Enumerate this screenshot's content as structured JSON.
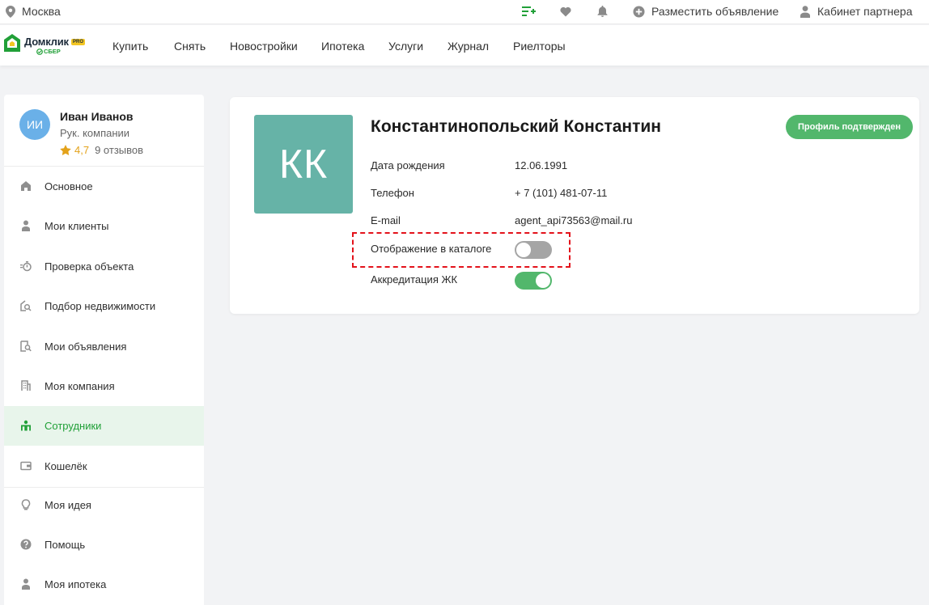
{
  "topbar": {
    "city": "Москва",
    "post_ad": "Разместить объявление",
    "partner_cabinet": "Кабинет партнера",
    "icons": [
      "location-icon",
      "list-add-icon",
      "heart-icon",
      "bell-icon",
      "plus-circle-icon",
      "user-icon"
    ]
  },
  "logo": {
    "word": "Домклик",
    "pro": "PRO",
    "sber": "СБЕР"
  },
  "nav": {
    "items": [
      {
        "label": "Купить"
      },
      {
        "label": "Снять"
      },
      {
        "label": "Новостройки"
      },
      {
        "label": "Ипотека"
      },
      {
        "label": "Услуги"
      },
      {
        "label": "Журнал"
      },
      {
        "label": "Риелторы"
      }
    ]
  },
  "user": {
    "initials": "ИИ",
    "name": "Иван Иванов",
    "role": "Рук. компании",
    "rating": "4,7",
    "reviews": "9 отзывов"
  },
  "sidebar": {
    "items": [
      {
        "label": "Основное",
        "icon": "home-icon"
      },
      {
        "label": "Мои клиенты",
        "icon": "person-icon"
      },
      {
        "label": "Проверка объекта",
        "icon": "check-object-icon"
      },
      {
        "label": "Подбор недвижимости",
        "icon": "house-search-icon"
      },
      {
        "label": "Мои объявления",
        "icon": "document-search-icon"
      },
      {
        "label": "Моя компания",
        "icon": "building-icon"
      },
      {
        "label": "Сотрудники",
        "icon": "employees-icon",
        "active": true
      },
      {
        "label": "Кошелёк",
        "icon": "wallet-icon"
      },
      {
        "label": "Моя идея",
        "icon": "lightbulb-icon"
      },
      {
        "label": "Помощь",
        "icon": "help-icon"
      },
      {
        "label": "Моя ипотека",
        "icon": "person-icon"
      }
    ]
  },
  "profile": {
    "initials": "КК",
    "full_name": "Константинопольский Константин",
    "verified_label": "Профиль подтвержден",
    "birth_label": "Дата рождения",
    "birth_value": "12.06.1991",
    "phone_label": "Телефон",
    "phone_value": "+ 7 (101) 481-07-11",
    "email_label": "E-mail",
    "email_value": "agent_api73563@mail.ru",
    "catalog_label": "Отображение в каталоге",
    "catalog_on": false,
    "accreditation_label": "Аккредитация ЖК",
    "accreditation_on": true
  },
  "colors": {
    "accent_green": "#21a038",
    "toggle_green": "#52b76c",
    "avatar_teal": "#66b3a7",
    "user_avatar_blue": "#6ab0e8",
    "star": "#e3a21a",
    "highlight_red": "#e3121b"
  }
}
